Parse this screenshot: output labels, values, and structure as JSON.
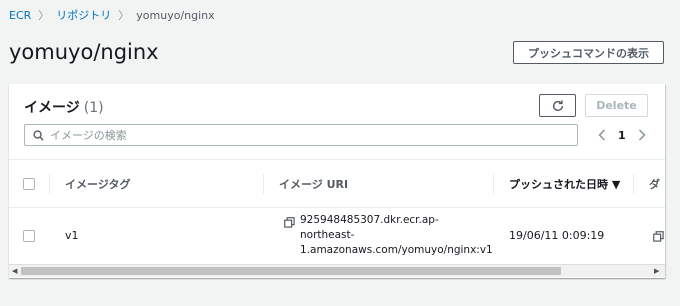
{
  "breadcrumb": {
    "items": [
      "ECR",
      "リポジトリ"
    ],
    "current": "yomuyo/nginx"
  },
  "page": {
    "title": "yomuyo/nginx",
    "push_commands_label": "プッシュコマンドの表示"
  },
  "panel": {
    "title": "イメージ",
    "count": "(1)",
    "delete_label": "Delete",
    "search_placeholder": "イメージの検索",
    "page_number": "1"
  },
  "table": {
    "columns": [
      "イメージタグ",
      "イメージ URI",
      "プッシュされた日時 ▼",
      "ダ"
    ],
    "rows": [
      {
        "tag": "v1",
        "uri_line1": "925948485307.dkr.ecr.ap-",
        "uri_line2": "northeast-",
        "uri_line3": "1.amazonaws.com/yomuyo/nginx:v1",
        "pushed_at": "19/06/11 0:09:19"
      }
    ]
  },
  "colors": {
    "link": "#0073bb",
    "background": "#f2f3f3",
    "border": "#545b64"
  }
}
